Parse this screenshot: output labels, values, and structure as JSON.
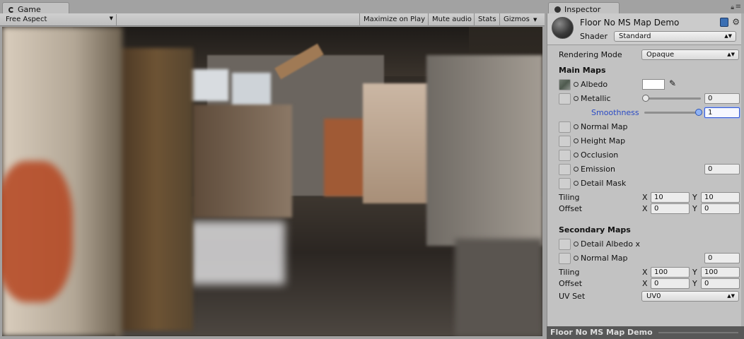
{
  "game": {
    "tab_label": "Game",
    "aspect": "Free Aspect",
    "toolbar": {
      "maximize": "Maximize on Play",
      "mute": "Mute audio",
      "stats": "Stats",
      "gizmos": "Gizmos"
    }
  },
  "inspector": {
    "tab_label": "Inspector",
    "material_name": "Floor No MS Map Demo",
    "shader_label": "Shader",
    "shader_value": "Standard",
    "rendering_mode_label": "Rendering Mode",
    "rendering_mode_value": "Opaque",
    "main_maps_title": "Main Maps",
    "albedo": "Albedo",
    "metallic": "Metallic",
    "metallic_value": "0",
    "smoothness": "Smoothness",
    "smoothness_value": "1",
    "normal_map": "Normal Map",
    "height_map": "Height Map",
    "occlusion": "Occlusion",
    "emission": "Emission",
    "emission_value": "0",
    "detail_mask": "Detail Mask",
    "tiling_label": "Tiling",
    "offset_label": "Offset",
    "x_label": "X",
    "y_label": "Y",
    "main_tiling_x": "10",
    "main_tiling_y": "10",
    "main_offset_x": "0",
    "main_offset_y": "0",
    "secondary_maps_title": "Secondary Maps",
    "detail_albedo": "Detail Albedo x",
    "sec_normal_map": "Normal Map",
    "sec_normal_value": "0",
    "sec_tiling_x": "100",
    "sec_tiling_y": "100",
    "sec_offset_x": "0",
    "sec_offset_y": "0",
    "uv_set_label": "UV Set",
    "uv_set_value": "UV0",
    "footer_title": "Floor No MS Map Demo"
  }
}
